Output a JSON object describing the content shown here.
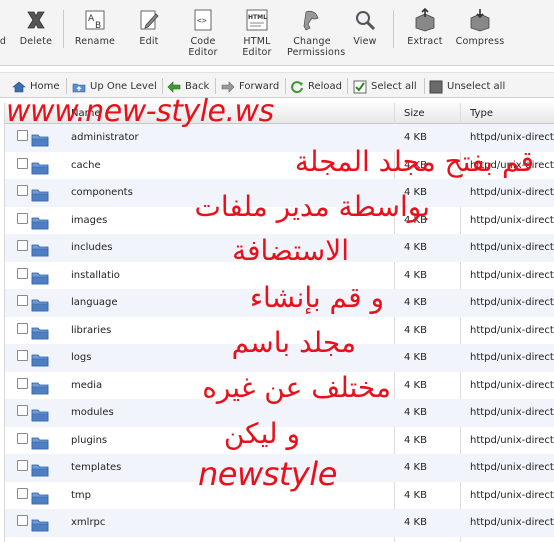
{
  "toolbar": {
    "items": [
      {
        "label": "d",
        "icon": "cut-icon"
      },
      {
        "label": "Delete",
        "icon": "delete-x-icon"
      },
      {
        "label": "Rename",
        "icon": "rename-ab-icon"
      },
      {
        "label": "Edit",
        "icon": "edit-pencil-icon"
      },
      {
        "label": "Code Editor",
        "icon": "code-editor-icon"
      },
      {
        "label": "HTML Editor",
        "icon": "html-editor-icon"
      },
      {
        "label": "Change Permissions",
        "icon": "permissions-key-icon"
      },
      {
        "label": "View",
        "icon": "magnifier-icon"
      },
      {
        "label": "Extract",
        "icon": "extract-box-icon"
      },
      {
        "label": "Compress",
        "icon": "compress-box-icon"
      }
    ]
  },
  "navbar": {
    "home": "Home",
    "up": "Up One Level",
    "back": "Back",
    "forward": "Forward",
    "reload": "Reload",
    "select_all": "Select all",
    "unselect_all": "Unselect all"
  },
  "table": {
    "headers": {
      "name": "Name",
      "size": "Size",
      "type": "Type"
    },
    "rows": [
      {
        "name": "administrator",
        "size": "4 KB",
        "type": "httpd/unix-directo"
      },
      {
        "name": "cache",
        "size": "4 KB",
        "type": "httpd/unix-directo"
      },
      {
        "name": "components",
        "size": "4 KB",
        "type": "httpd/unix-directo"
      },
      {
        "name": "images",
        "size": "4 KB",
        "type": "httpd/unix-directo"
      },
      {
        "name": "includes",
        "size": "4 KB",
        "type": "httpd/unix-directo"
      },
      {
        "name": "installatio",
        "size": "4 KB",
        "type": "httpd/unix-directo"
      },
      {
        "name": "language",
        "size": "4 KB",
        "type": "httpd/unix-directo"
      },
      {
        "name": "libraries",
        "size": "4 KB",
        "type": "httpd/unix-directo"
      },
      {
        "name": "logs",
        "size": "4 KB",
        "type": "httpd/unix-directo"
      },
      {
        "name": "media",
        "size": "4 KB",
        "type": "httpd/unix-directo"
      },
      {
        "name": "modules",
        "size": "4 KB",
        "type": "httpd/unix-directo"
      },
      {
        "name": "plugins",
        "size": "4 KB",
        "type": "httpd/unix-directo"
      },
      {
        "name": "templates",
        "size": "4 KB",
        "type": "httpd/unix-directo"
      },
      {
        "name": "tmp",
        "size": "4 KB",
        "type": "httpd/unix-directo"
      },
      {
        "name": "xmlrpc",
        "size": "4 KB",
        "type": "httpd/unix-directo"
      }
    ]
  },
  "overlay": {
    "watermark": "www.new-style.ws",
    "lines": [
      "قم بفتح مجلد المجلة",
      "بواسطة مدير ملفات",
      "الاستضافة",
      "و قم بإنشاء",
      "مجلد باسم",
      "مختلف عن غيره",
      "و ليكن"
    ],
    "brand": "newstyle",
    "color": "#e8111b"
  }
}
